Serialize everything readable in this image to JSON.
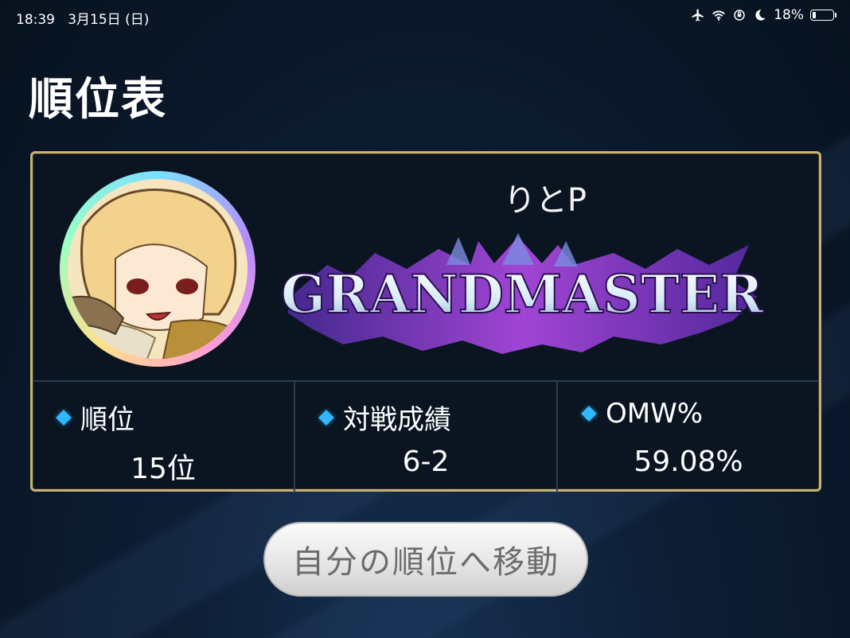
{
  "status_bar": {
    "time": "18:39",
    "date": "3月15日 (日)",
    "battery": "18%",
    "battery_level": 0.18,
    "icons": [
      "airplane-icon",
      "wifi-icon",
      "orientation-lock-icon",
      "moon-icon",
      "battery-icon"
    ]
  },
  "page": {
    "title": "順位表"
  },
  "player": {
    "name": "りとP",
    "rank": "GRANDMASTER",
    "avatar": "avatar-character-icon"
  },
  "stats": [
    {
      "label": "順位",
      "value": "15位"
    },
    {
      "label": "対戦成績",
      "value": "6-2"
    },
    {
      "label": "OMW%",
      "value": "59.08%"
    }
  ],
  "actions": {
    "move_to_rank": "自分の順位へ移動"
  },
  "colors": {
    "accent": "#2fb7ff",
    "frame": "#c8b27a",
    "emblem": "#a63df0"
  }
}
